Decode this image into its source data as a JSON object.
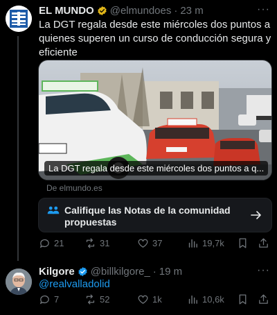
{
  "tweet1": {
    "name": "EL MUNDO",
    "handle": "@elmundoes",
    "separator": "·",
    "time": "23 m",
    "more": "···",
    "text": "La DGT regala desde este miércoles dos puntos a quienes superen un curso de conducción segura y eficiente",
    "card": {
      "caption": "La DGT regala desde este miércoles dos puntos a q...",
      "domain": "De elmundo.es",
      "image_text": {
        "car_brand": "rubi-aan",
        "plate": "3 GBV",
        "school_label": "L"
      }
    },
    "notes_prompt": "Califique las Notas de la comunidad propuestas",
    "actions": {
      "replies": "21",
      "reposts": "31",
      "likes": "37",
      "views": "19,7k"
    },
    "badge_color": "#e2b719"
  },
  "tweet2": {
    "name": "Kilgore",
    "handle": "@billkilgore_",
    "separator": "·",
    "time": "19 m",
    "more": "···",
    "mention": "@realvalladolid",
    "actions": {
      "replies": "7",
      "reposts": "52",
      "likes": "1k",
      "views": "10,6k"
    },
    "badge_color": "#1d9bf0"
  },
  "colors": {
    "background": "#000000",
    "text": "#e7e9ea",
    "muted": "#71767b",
    "link": "#1d9bf0"
  }
}
